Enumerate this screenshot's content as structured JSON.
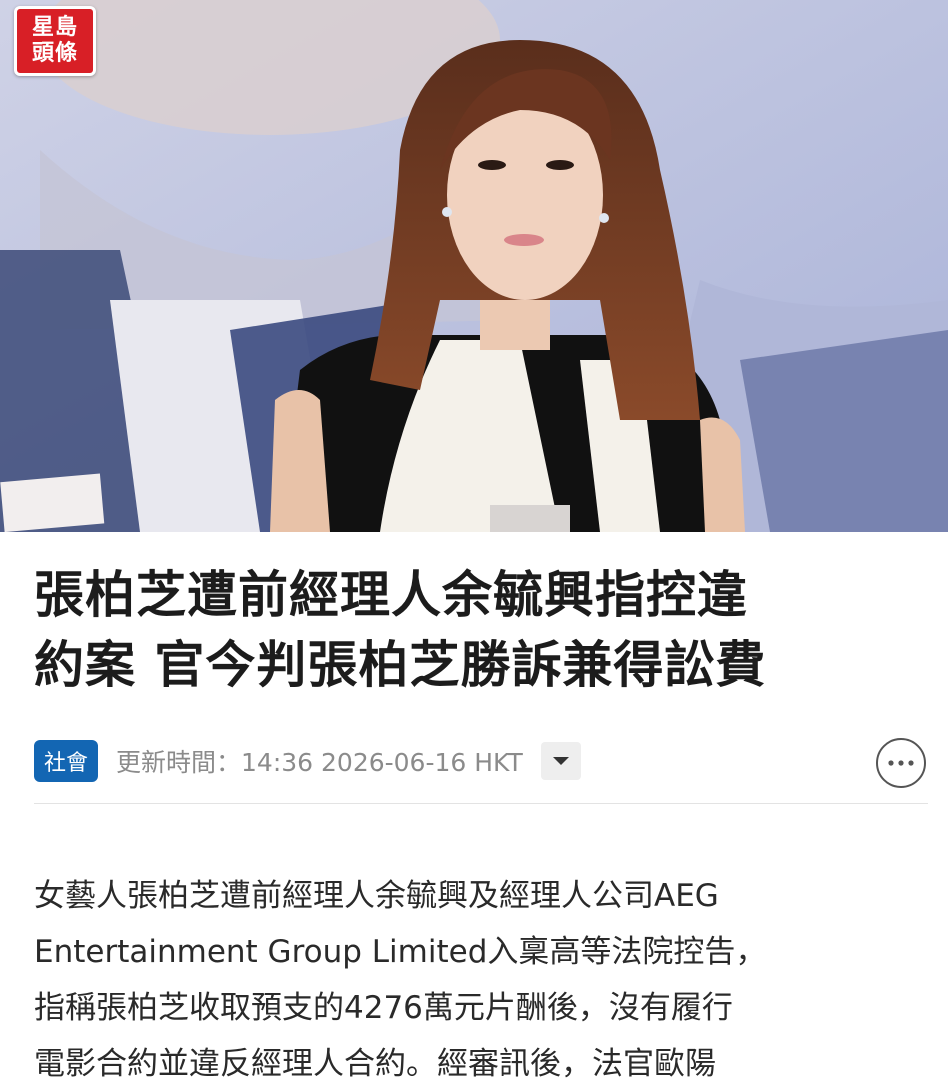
{
  "hero": {
    "logo_line1": "星島",
    "logo_line2": "頭條"
  },
  "article": {
    "headline_line1": "張柏芝遭前經理人余毓興指控違",
    "headline_line2": "約案  官今判張柏芝勝訴兼得訟費",
    "category": "社會",
    "updated": "更新時間：14:36 2026-06-16 HKT",
    "body_lines": [
      "女藝人張柏芝遭前經理人余毓興及經理人公司AEG",
      "Entertainment Group Limited入稟高等法院控告，",
      "指稱張柏芝收取預支的4276萬元片酬後，沒有履行",
      "電影合約並違反經理人合約。經審訊後，法官歐陽"
    ]
  },
  "icons": {
    "dropdown": "chevron-down-icon",
    "more": "more-options-icon"
  },
  "colors": {
    "tag_bg": "#1366b3",
    "logo_bg": "#d81f26"
  }
}
